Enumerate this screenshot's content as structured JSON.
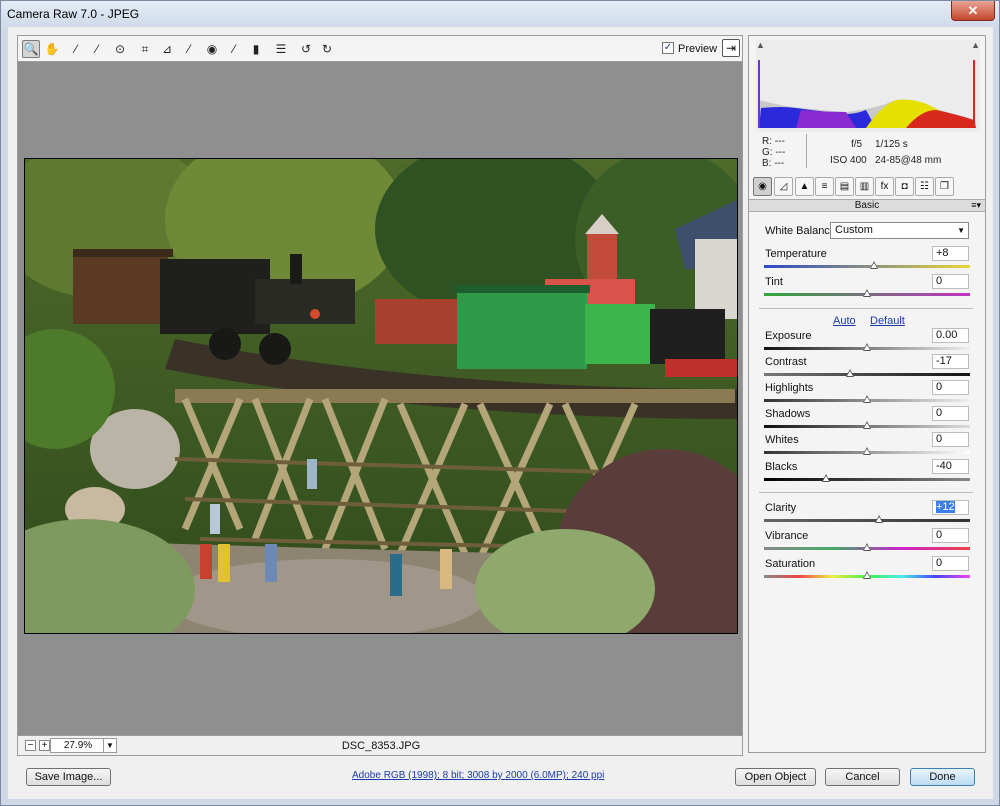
{
  "window": {
    "title": "Camera Raw 7.0  -  JPEG",
    "close_glyph": "✕"
  },
  "toolbar": {
    "tools": [
      {
        "name": "zoom-tool",
        "glyph": "🔍"
      },
      {
        "name": "hand-tool",
        "glyph": "✋"
      },
      {
        "name": "white-balance-tool",
        "glyph": "⁄"
      },
      {
        "name": "color-sampler-tool",
        "glyph": "⁄"
      },
      {
        "name": "targeted-adjustment-tool",
        "glyph": "⊙"
      },
      {
        "name": "crop-tool",
        "glyph": "⌗"
      },
      {
        "name": "straighten-tool",
        "glyph": "⊿"
      },
      {
        "name": "spot-removal-tool",
        "glyph": "⁄"
      },
      {
        "name": "red-eye-tool",
        "glyph": "◉"
      },
      {
        "name": "adjustment-brush-tool",
        "glyph": "⁄"
      },
      {
        "name": "graduated-filter-tool",
        "glyph": "▮"
      },
      {
        "name": "preferences-tool",
        "glyph": "☰"
      },
      {
        "name": "rotate-left-tool",
        "glyph": "↺"
      },
      {
        "name": "rotate-right-tool",
        "glyph": "↻"
      }
    ],
    "preview_label": "Preview",
    "preview_checked": "✓"
  },
  "status": {
    "zoom_value": "27.9%",
    "zoom_minus": "−",
    "zoom_plus": "+",
    "filename": "DSC_8353.JPG"
  },
  "readout": {
    "r": "R:  ---",
    "g": "G:  ---",
    "b": "B:  ---",
    "aperture": "f/5",
    "shutter": "1/125 s",
    "iso": "ISO 400",
    "lens": "24-85@48 mm"
  },
  "panel": {
    "section_title": "Basic",
    "white_balance_label": "White Balance:",
    "white_balance_value": "Custom",
    "auto_label": "Auto",
    "default_label": "Default",
    "sliders": [
      {
        "label": "Temperature",
        "value": "+8"
      },
      {
        "label": "Tint",
        "value": "0"
      },
      {
        "label": "Exposure",
        "value": "0.00"
      },
      {
        "label": "Contrast",
        "value": "-17"
      },
      {
        "label": "Highlights",
        "value": "0"
      },
      {
        "label": "Shadows",
        "value": "0"
      },
      {
        "label": "Whites",
        "value": "0"
      },
      {
        "label": "Blacks",
        "value": "-40"
      },
      {
        "label": "Clarity",
        "value": "+12"
      },
      {
        "label": "Vibrance",
        "value": "0"
      },
      {
        "label": "Saturation",
        "value": "0"
      }
    ]
  },
  "footer": {
    "save_label": "Save Image...",
    "info_link": "Adobe RGB (1998); 8 bit; 3008 by 2000 (6.0MP); 240 ppi",
    "open_label": "Open Object",
    "cancel_label": "Cancel",
    "done_label": "Done"
  },
  "colors": {
    "accent": "#3b7ee6",
    "link": "#1a3ba8"
  }
}
